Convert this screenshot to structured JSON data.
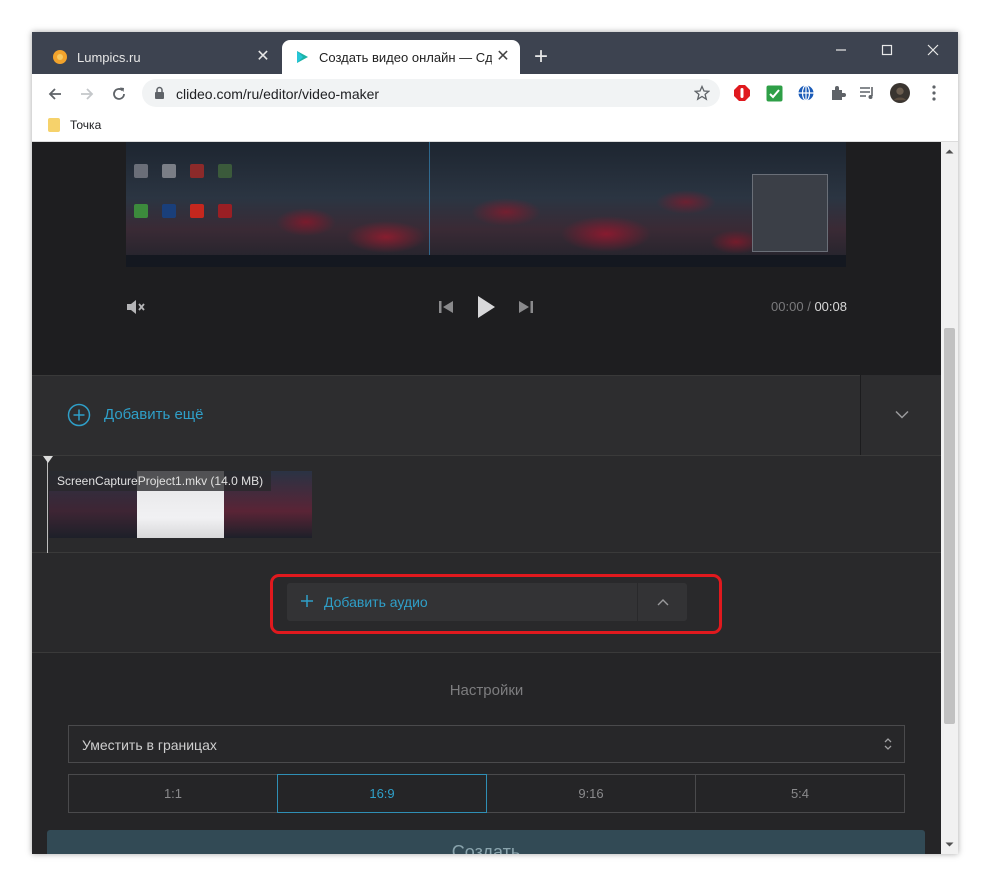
{
  "browser": {
    "tabs": [
      {
        "title": "Lumpics.ru",
        "close": "✕"
      },
      {
        "title": "Создать видео онлайн — Сдела",
        "close": "✕"
      }
    ],
    "new_tab": "+",
    "url": "clideo.com/ru/editor/video-maker",
    "bookmark": "Точка"
  },
  "player": {
    "time_current": "00:00",
    "time_separator": "/",
    "time_total": "00:08"
  },
  "editor": {
    "add_more_label": "Добавить ещё",
    "clip_label": "ScreenCaptureProject1.mkv (14.0 MB)",
    "add_audio_label": "Добавить аудио"
  },
  "settings": {
    "title": "Настройки",
    "fit_option": "Уместить в границах",
    "ratios": [
      "1:1",
      "16:9",
      "9:16",
      "5:4"
    ],
    "active_ratio": "16:9"
  },
  "footer": {
    "create_label": "Создать"
  },
  "colors": {
    "accent": "#2f9fc8",
    "highlight": "#e0191e",
    "create_button": "#324a55"
  }
}
